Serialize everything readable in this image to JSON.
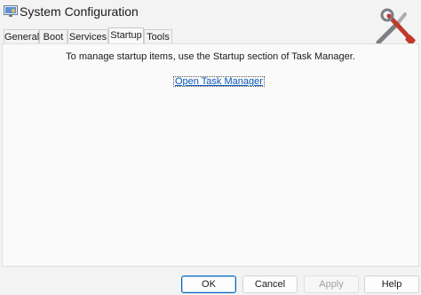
{
  "window": {
    "title": "System Configuration",
    "icon": "system-config-icon"
  },
  "tabs": [
    {
      "label": "General"
    },
    {
      "label": "Boot"
    },
    {
      "label": "Services"
    },
    {
      "label": "Startup",
      "active": true
    },
    {
      "label": "Tools"
    }
  ],
  "startup": {
    "message": "To manage startup items, use the Startup section of Task Manager.",
    "link_label": "Open Task Manager"
  },
  "buttons": {
    "ok": "OK",
    "cancel": "Cancel",
    "apply": "Apply",
    "help": "Help"
  },
  "colors": {
    "link": "#0b58b8",
    "default_button_border": "#0067c0"
  }
}
